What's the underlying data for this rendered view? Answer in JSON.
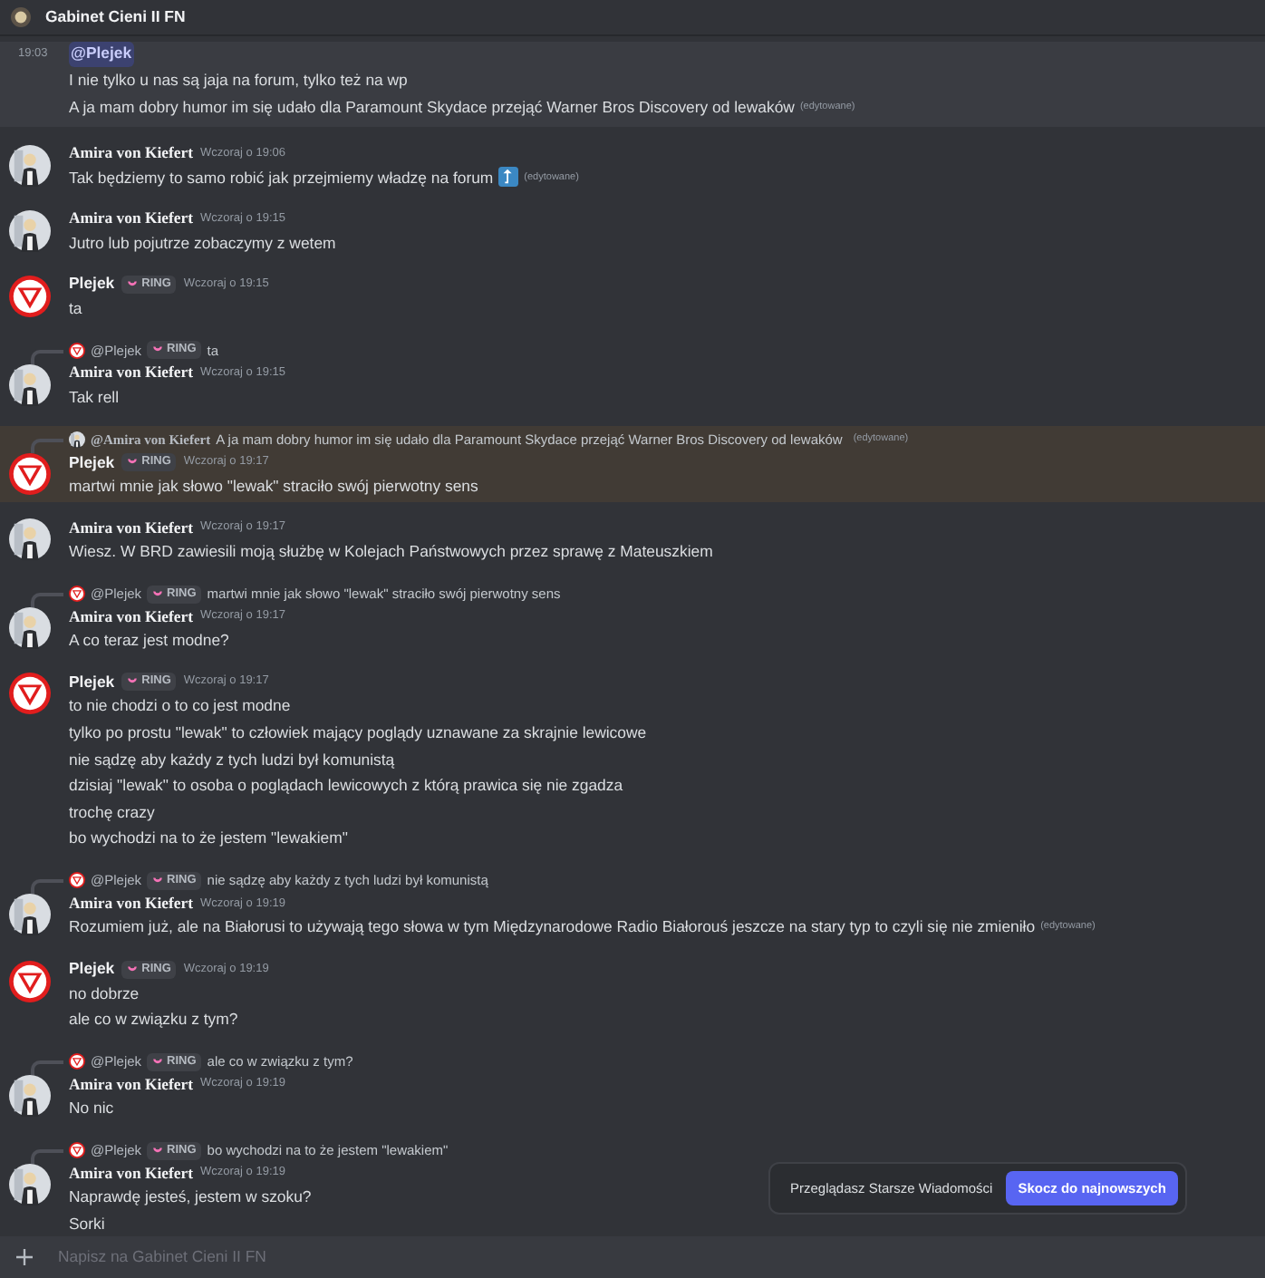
{
  "channel": {
    "title": "Gabinet Cieni II FN"
  },
  "messages": [
    {
      "kind": "continuation",
      "time": "19:03",
      "mention": "@Plejek",
      "highlighted": false,
      "hovered": true,
      "lines": [
        {
          "text": "I nie tylko u nas są jaja na forum, tylko też na wp",
          "emoji": false
        },
        {
          "text": "A ja mam dobry humor im się udało dla Paramount Skydace przejąć Warner Bros Discovery od lewaków",
          "edited": "(edytowane)",
          "emoji": false
        }
      ]
    },
    {
      "kind": "group",
      "author": "Amira von Kiefert",
      "avatar": {
        "kind": "photo"
      },
      "time": "Wczoraj o 19:06",
      "highlighted": false,
      "lines": [
        {
          "text": "Tak będziemy to samo robić jak przejmiemy władzę na forum",
          "edited": "(edytowane)",
          "emoji": true
        }
      ]
    },
    {
      "kind": "group",
      "author": "Amira von Kiefert",
      "avatar": {
        "kind": "photo"
      },
      "time": "Wczoraj o 19:15",
      "highlighted": false,
      "lines": [
        {
          "text": "Jutro lub pojutrze zobaczymy z wetem",
          "emoji": false
        }
      ]
    },
    {
      "kind": "group",
      "author": "Plejek",
      "avatar": {
        "kind": "sign"
      },
      "badge": "RING",
      "time": "Wczoraj o 19:15",
      "highlighted": false,
      "lines": [
        {
          "text": "ta",
          "emoji": false
        }
      ]
    },
    {
      "kind": "group",
      "author": "Amira von Kiefert",
      "avatar": {
        "kind": "photo"
      },
      "time": "Wczoraj o 19:15",
      "highlighted": false,
      "reply": {
        "author": "@Plejek",
        "avatar": {
          "kind": "sign"
        },
        "badge": "RING",
        "text": "ta"
      },
      "lines": [
        {
          "text": "Tak rell",
          "emoji": false
        }
      ]
    },
    {
      "kind": "group",
      "author": "Plejek",
      "avatar": {
        "kind": "sign"
      },
      "badge": "RING",
      "time": "Wczoraj o 19:17",
      "highlighted": true,
      "reply": {
        "author": "@Amira von Kiefert",
        "avatar": {
          "kind": "photo"
        },
        "text": "A ja mam dobry humor im się udało dla Paramount Skydace przejąć Warner Bros Discovery od lewaków",
        "edited": "(edytowane)"
      },
      "lines": [
        {
          "text": "martwi mnie jak słowo \"lewak\" straciło swój pierwotny sens",
          "emoji": false
        }
      ]
    },
    {
      "kind": "group",
      "author": "Amira von Kiefert",
      "avatar": {
        "kind": "photo"
      },
      "time": "Wczoraj o 19:17",
      "highlighted": false,
      "lines": [
        {
          "text": "Wiesz. W BRD zawiesili moją służbę w Kolejach Państwowych przez sprawę z Mateuszkiem",
          "emoji": false
        }
      ]
    },
    {
      "kind": "group",
      "author": "Amira von Kiefert",
      "avatar": {
        "kind": "photo"
      },
      "time": "Wczoraj o 19:17",
      "highlighted": false,
      "reply": {
        "author": "@Plejek",
        "avatar": {
          "kind": "sign"
        },
        "badge": "RING",
        "text": "martwi mnie jak słowo \"lewak\" straciło swój pierwotny sens"
      },
      "lines": [
        {
          "text": "A co teraz jest modne?",
          "emoji": false
        }
      ]
    },
    {
      "kind": "group",
      "author": "Plejek",
      "avatar": {
        "kind": "sign"
      },
      "badge": "RING",
      "time": "Wczoraj o 19:17",
      "highlighted": false,
      "lines": [
        {
          "text": "to nie chodzi o to co jest modne",
          "emoji": false
        },
        {
          "text": "tylko po prostu \"lewak\"  to człowiek mający poglądy uznawane za skrajnie lewicowe",
          "emoji": false
        },
        {
          "text": "nie sądzę aby każdy z tych ludzi był komunistą",
          "emoji": false
        },
        {
          "text": "dzisiaj \"lewak\" to osoba o poglądach lewicowych z którą prawica się nie zgadza",
          "emoji": false
        },
        {
          "text": "trochę crazy",
          "emoji": false
        },
        {
          "text": "bo wychodzi na to że jestem \"lewakiem\"",
          "emoji": false
        }
      ]
    },
    {
      "kind": "group",
      "author": "Amira von Kiefert",
      "avatar": {
        "kind": "photo"
      },
      "time": "Wczoraj o 19:19",
      "highlighted": false,
      "reply": {
        "author": "@Plejek",
        "avatar": {
          "kind": "sign"
        },
        "badge": "RING",
        "text": "nie sądzę aby każdy z tych ludzi był komunistą"
      },
      "lines": [
        {
          "text": "Rozumiem już, ale na Białorusi to używają tego słowa w tym Międzynarodowe Radio Białorouś jeszcze na stary typ to czyli się nie zmieniło",
          "edited": "(edytowane)",
          "emoji": false
        }
      ]
    },
    {
      "kind": "group",
      "author": "Plejek",
      "avatar": {
        "kind": "sign"
      },
      "badge": "RING",
      "time": "Wczoraj o 19:19",
      "highlighted": false,
      "lines": [
        {
          "text": "no dobrze",
          "emoji": false
        },
        {
          "text": "ale co w związku z tym?",
          "emoji": false
        }
      ]
    },
    {
      "kind": "group",
      "author": "Amira von Kiefert",
      "avatar": {
        "kind": "photo"
      },
      "time": "Wczoraj o 19:19",
      "highlighted": false,
      "reply": {
        "author": "@Plejek",
        "avatar": {
          "kind": "sign"
        },
        "badge": "RING",
        "text": "ale co w związku z tym?"
      },
      "lines": [
        {
          "text": "No nic",
          "emoji": false
        }
      ]
    },
    {
      "kind": "group",
      "author": "Amira von Kiefert",
      "avatar": {
        "kind": "photo"
      },
      "time": "Wczoraj o 19:19",
      "highlighted": false,
      "reply": {
        "author": "@Plejek",
        "avatar": {
          "kind": "sign"
        },
        "badge": "RING",
        "text": "bo wychodzi na to że jestem \"lewakiem\""
      },
      "lines": [
        {
          "text": "Naprawdę jesteś, jestem w szoku?",
          "emoji": false
        },
        {
          "text": "Sorki",
          "emoji": false
        }
      ]
    }
  ],
  "jump_bar": {
    "text": "Przeglądasz Starsze Wiadomości",
    "button": "Skocz do najnowszych"
  },
  "composer": {
    "placeholder": "Napisz na Gabinet Cieni II FN"
  }
}
